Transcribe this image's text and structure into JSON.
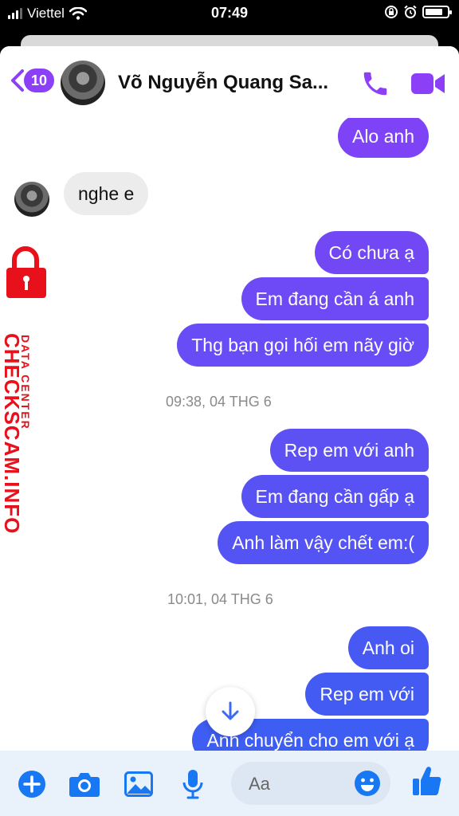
{
  "status": {
    "carrier": "Viettel",
    "time": "07:49",
    "battery": 0.82
  },
  "header": {
    "back_count": "10",
    "contact_name": "Võ Nguyễn Quang Sa..."
  },
  "messages": [
    {
      "text": "Alo anh"
    },
    {
      "text": "nghe e"
    },
    {
      "text": "Có chưa ạ"
    },
    {
      "text": "Em đang cần á anh"
    },
    {
      "text": "Thg bạn gọi hối em nãy giờ"
    },
    {
      "text": "Rep em với anh"
    },
    {
      "text": "Em đang cần gấp ạ"
    },
    {
      "text": "Anh làm vậy chết em:("
    },
    {
      "text": "Anh oi"
    },
    {
      "text": "Rep em với"
    },
    {
      "text": "Anh chuyển cho em với ạ"
    }
  ],
  "timestamps": [
    "09:38, 04 THG 6",
    "10:01, 04 THG 6"
  ],
  "composer": {
    "placeholder": "Aa"
  },
  "watermark": {
    "line1": "DATA CENTER",
    "line2": "CHECKSCAM.INFO"
  },
  "colors": {
    "accent": "#8b3ff7",
    "bubble_top": "#7f43f6",
    "bubble_bottom": "#3b5ef2",
    "incoming": "#ececec",
    "watermark": "#e8101a"
  },
  "icons": [
    "back-chevron",
    "phone",
    "video-camera",
    "plus-circle",
    "camera",
    "image",
    "microphone",
    "smile",
    "thumbs-up",
    "arrow-down"
  ]
}
